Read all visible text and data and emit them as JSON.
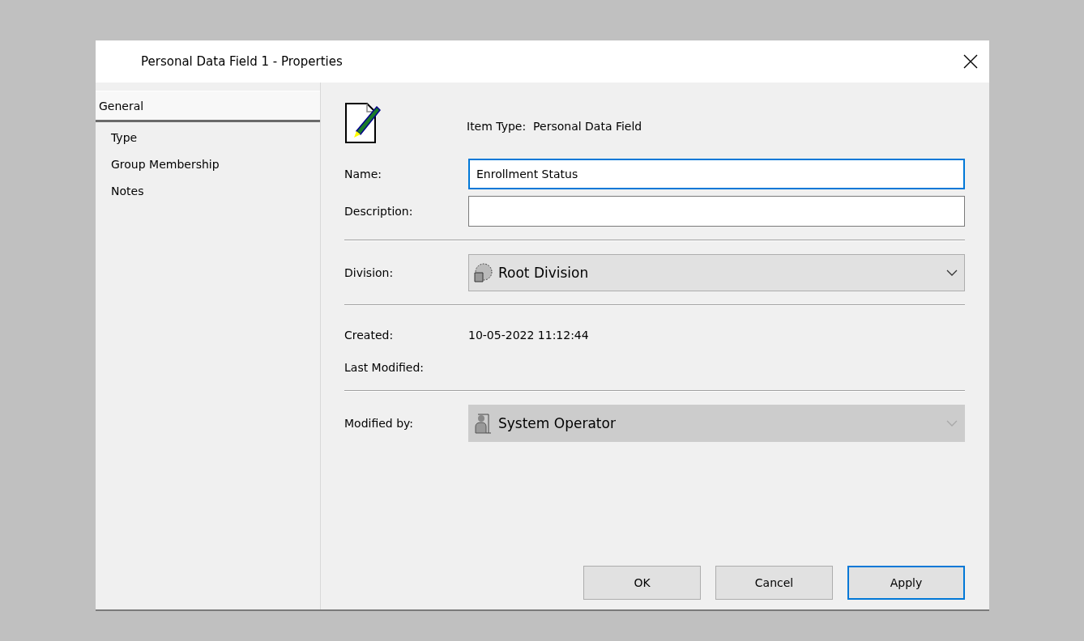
{
  "window": {
    "title": "Personal Data Field 1 - Properties"
  },
  "sidebar": {
    "items": [
      {
        "label": "General",
        "selected": true
      },
      {
        "label": "Type",
        "selected": false
      },
      {
        "label": "Group Membership",
        "selected": false
      },
      {
        "label": "Notes",
        "selected": false
      }
    ]
  },
  "item_type": {
    "label": "Item Type:",
    "value": "Personal Data Field"
  },
  "fields": [
    {
      "label": "Name:",
      "value": "Enrollment Status",
      "focused": true
    },
    {
      "label": "Description:",
      "focused": false
    }
  ],
  "division": {
    "label": "Division:",
    "value": "Root Division",
    "disabled": false
  },
  "created": {
    "label": "Created:",
    "value": "10-05-2022 11:12:44"
  },
  "last_modified": {
    "label": "Last Modified:"
  },
  "modified_by": {
    "label": "Modified by:",
    "value": "System Operator",
    "disabled": true
  },
  "buttons": [
    {
      "label": "OK",
      "default": false
    },
    {
      "label": "Cancel",
      "default": false
    },
    {
      "label": "Apply",
      "default": true
    }
  ]
}
